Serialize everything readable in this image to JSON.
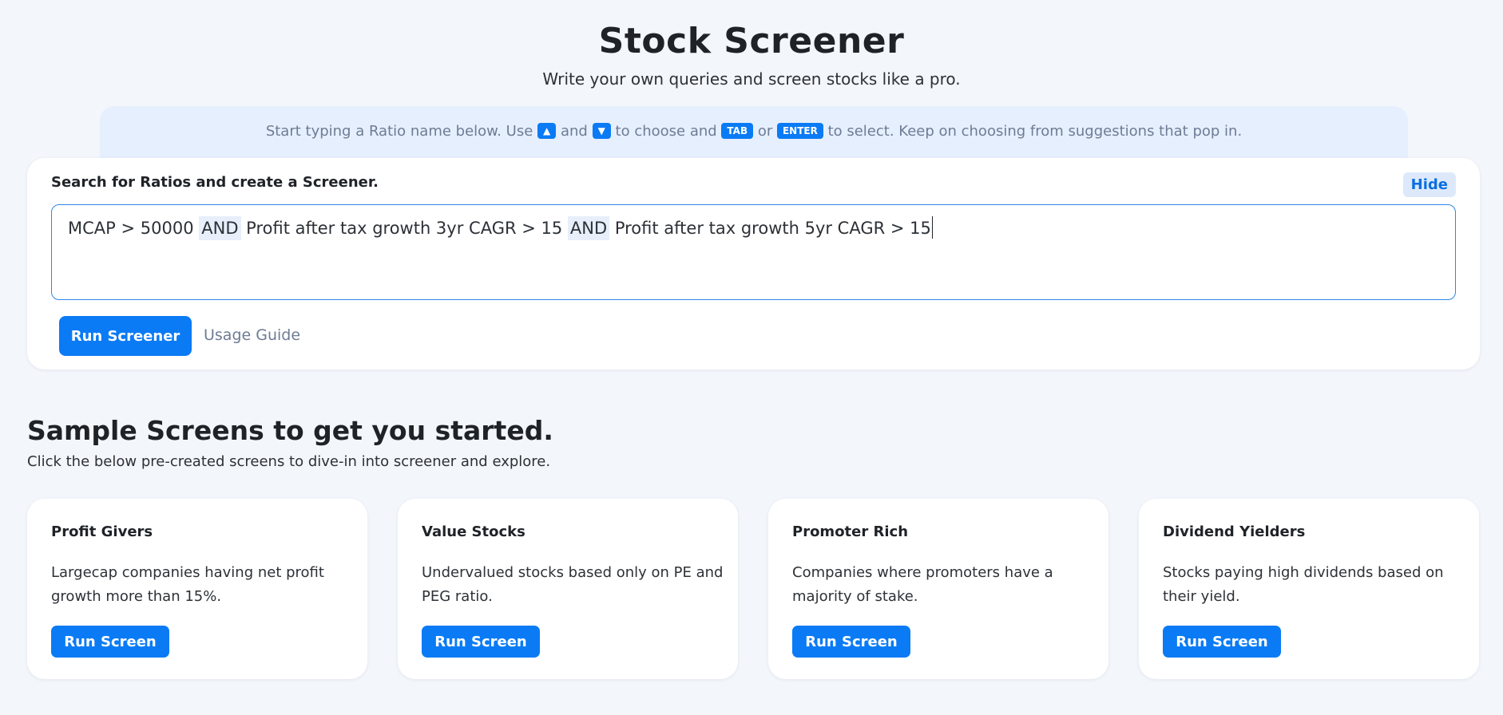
{
  "header": {
    "title": "Stock Screener",
    "subtitle": "Write your own queries and screen stocks like a pro."
  },
  "hint": {
    "part1": "Start typing a Ratio name below. Use ",
    "key_up": "▲",
    "part2": " and ",
    "key_down": "▼",
    "part3": " to choose and ",
    "key_tab": "TAB",
    "part4": " or ",
    "key_enter": "ENTER",
    "part5": " to select. Keep on choosing from suggestions that pop in."
  },
  "search": {
    "label": "Search for Ratios and create a Screener.",
    "hide_label": "Hide",
    "query_parts": [
      "MCAP > 50000 ",
      "AND",
      " Profit after tax growth 3yr CAGR > 15 ",
      "AND",
      " Profit after tax growth 5yr CAGR > 15"
    ],
    "run_label": "Run Screener",
    "usage_label": "Usage Guide"
  },
  "samples": {
    "title": "Sample Screens to get you started.",
    "subtitle": "Click the below pre-created screens to dive-in into screener and explore.",
    "cards": [
      {
        "title": "Profit Givers",
        "desc": "Largecap companies having net profit growth more than 15%.",
        "button": "Run Screen"
      },
      {
        "title": "Value Stocks",
        "desc": "Undervalued stocks based only on PE and PEG ratio.",
        "button": "Run Screen"
      },
      {
        "title": "Promoter Rich",
        "desc": "Companies where promoters have a majority of stake.",
        "button": "Run Screen"
      },
      {
        "title": "Dividend Yielders",
        "desc": "Stocks paying high dividends based on their yield.",
        "button": "Run Screen"
      }
    ]
  },
  "colors": {
    "accent": "#0a7bf5",
    "background": "#f3f6fb",
    "hint_background": "#e6effd",
    "muted_text": "#6e7c95"
  }
}
